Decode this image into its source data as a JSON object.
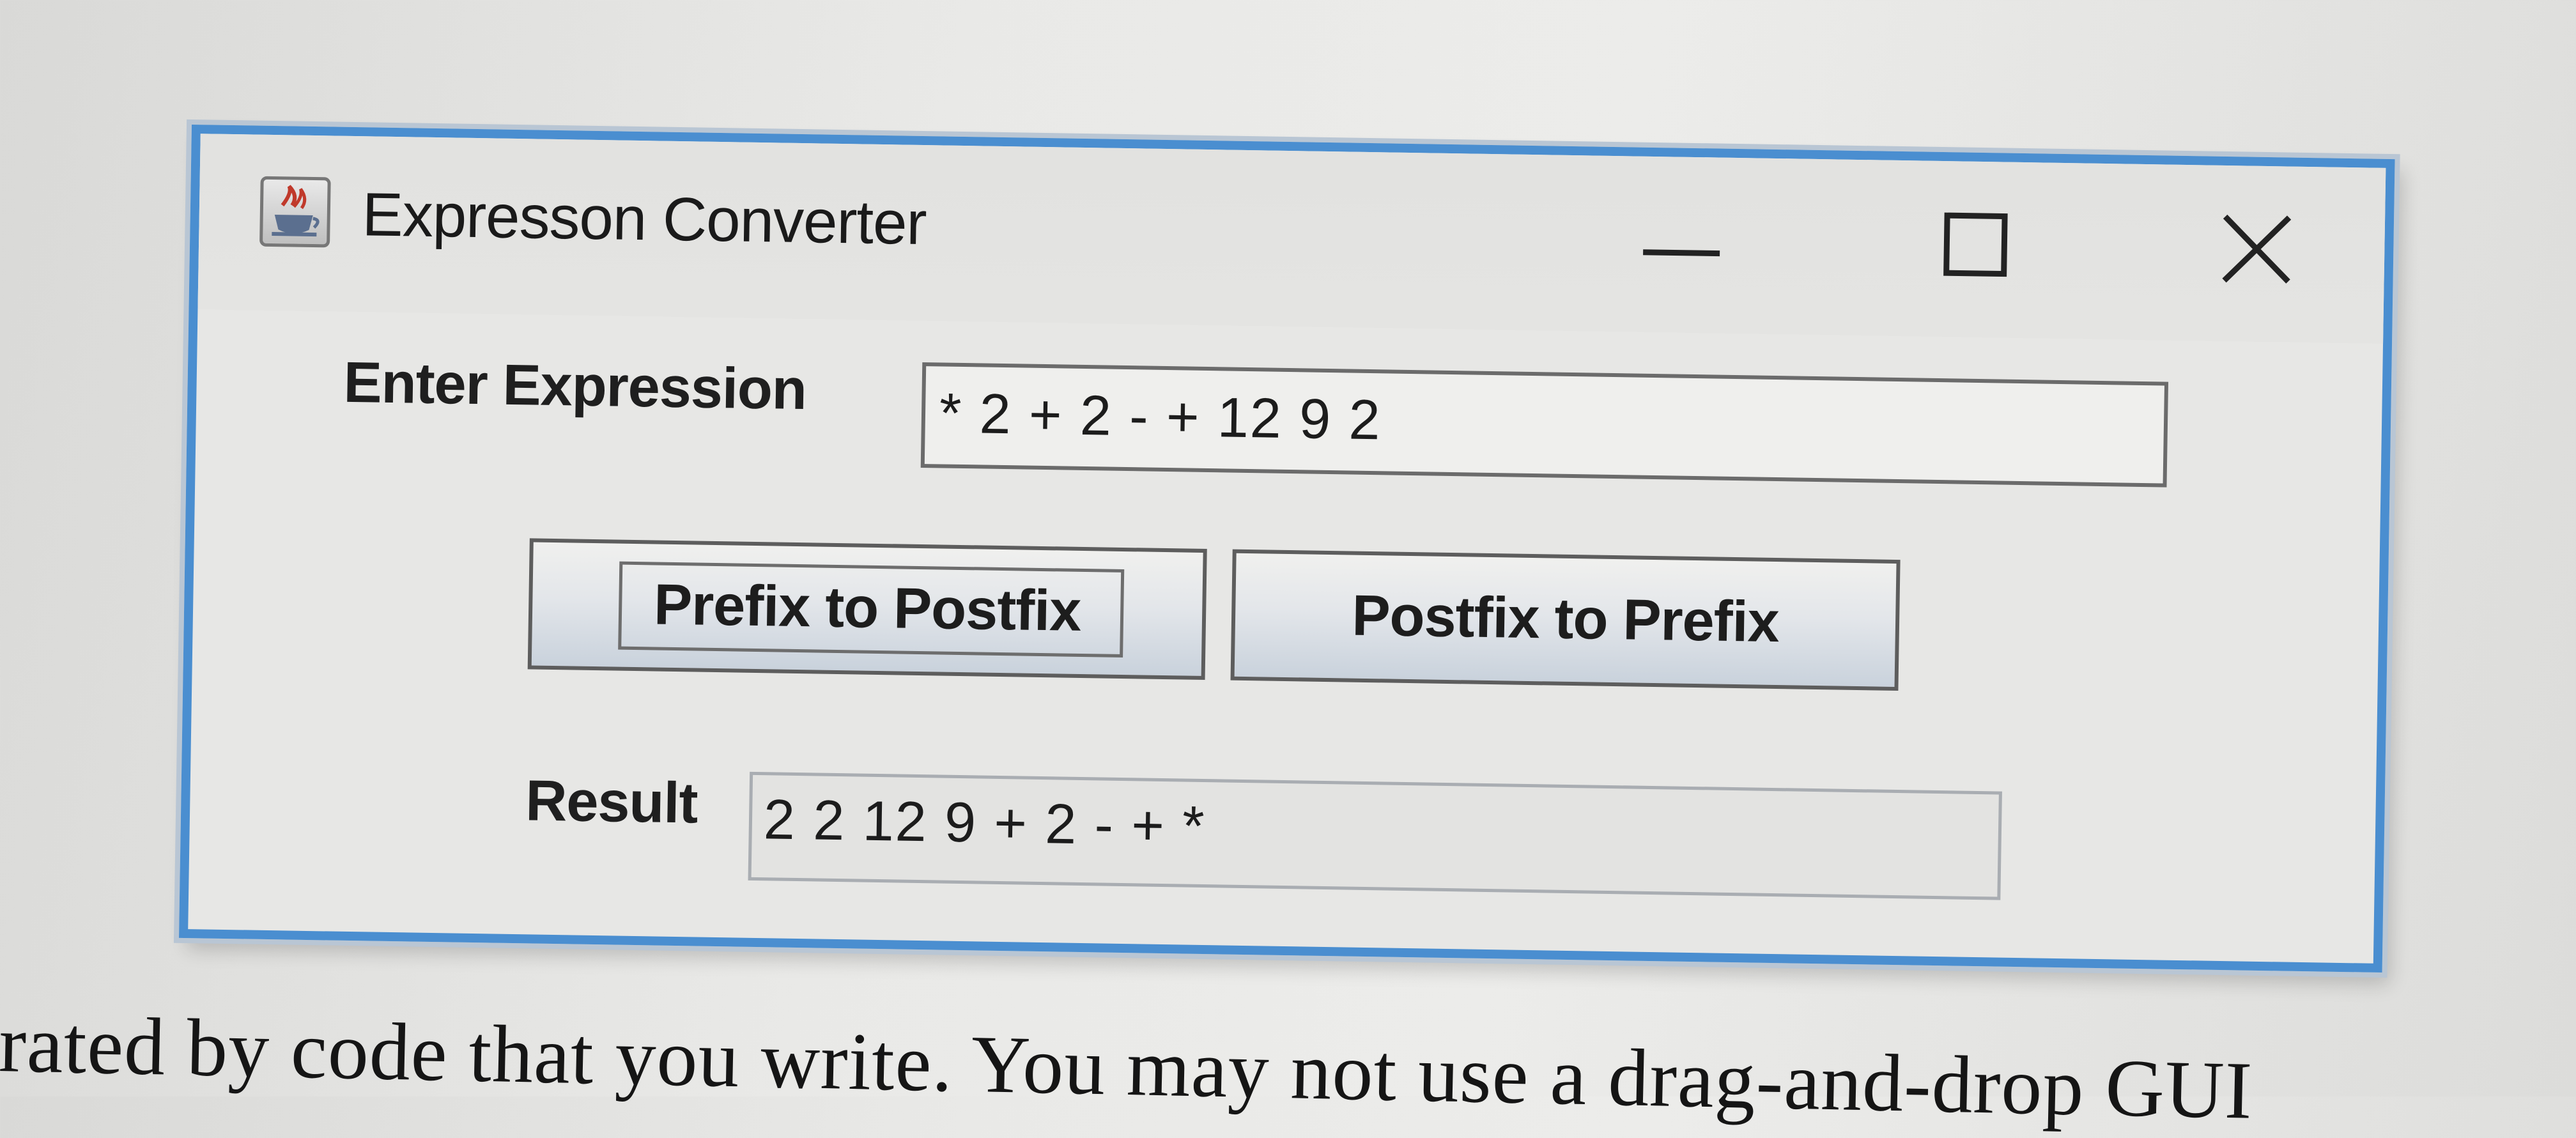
{
  "window": {
    "title": "Expresson Converter",
    "icon": "java-cup-icon",
    "controls": {
      "minimize": "minimize-icon",
      "maximize": "maximize-icon",
      "close": "close-icon"
    }
  },
  "form": {
    "expression_label": "Enter Expression",
    "expression_value": "* 2 + 2 - + 12 9 2",
    "prefix_to_postfix_label": "Prefix to Postfix",
    "postfix_to_prefix_label": "Postfix to Prefix",
    "result_label": "Result",
    "result_value": "2 2 12 9 + 2 - + *"
  },
  "document": {
    "text": "rated by code that you write. You may not use a drag-and-drop GUI"
  },
  "colors": {
    "window_border": "#4a8ed0",
    "window_background": "#e7e7e5"
  }
}
